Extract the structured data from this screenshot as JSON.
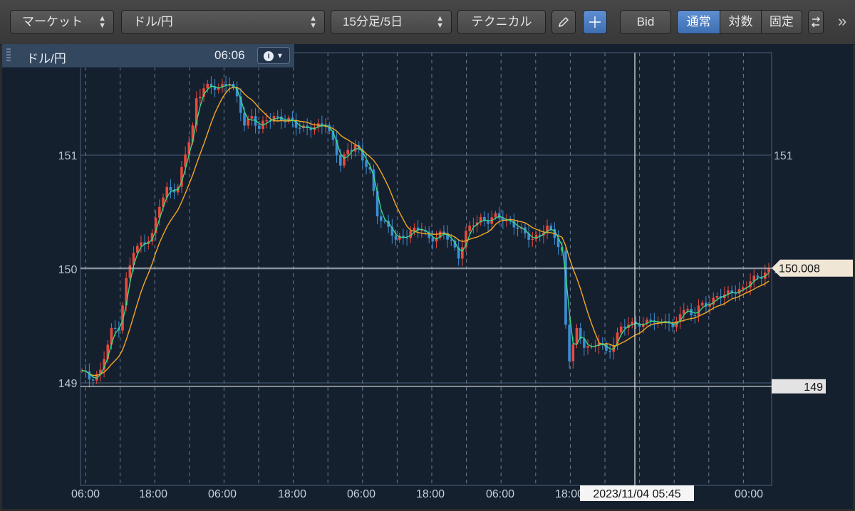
{
  "toolbar": {
    "market_select": "マーケット",
    "symbol_select": "ドル/円",
    "timeframe_select": "15分足/5日",
    "technical_button": "テクニカル",
    "pencil_icon": "pencil-icon",
    "crosshair_icon": "crosshair-icon",
    "bid_button": "Bid",
    "scale_modes": [
      "通常",
      "対数",
      "固定"
    ],
    "active_scale": "通常",
    "more_icon": "chevrons-right-icon",
    "swap_icon": "swap-icon"
  },
  "info_bar": {
    "symbol": "ドル/円",
    "time": "06:06",
    "info_icon": "info-icon"
  },
  "chart_data": {
    "type": "candlestick",
    "symbol": "ドル/円",
    "timeframe": "15分足/5日",
    "y_ticks_left": [
      "151",
      "150",
      "149"
    ],
    "y_ticks_right": [
      "151",
      "150",
      "149"
    ],
    "x_ticks": [
      "06:00",
      "18:00",
      "06:00",
      "18:00",
      "06:00",
      "18:00",
      "06:00",
      "18:00",
      "06:00",
      "00:00"
    ],
    "ylim": [
      148.1,
      151.9
    ],
    "current_price_label": "150.008",
    "current_price": 150.008,
    "crosshair_price_label": "149",
    "crosshair_price": 148.97,
    "crosshair_time_label": "2023/11/04 05:45",
    "close_path": [
      [
        0,
        149.09
      ],
      [
        2,
        149.04
      ],
      [
        5,
        149.1
      ],
      [
        8,
        149.45
      ],
      [
        10,
        149.5
      ],
      [
        12,
        149.9
      ],
      [
        14,
        150.15
      ],
      [
        17,
        150.25
      ],
      [
        19,
        150.3
      ],
      [
        21,
        150.55
      ],
      [
        23,
        150.7
      ],
      [
        26,
        150.72
      ],
      [
        28,
        151.0
      ],
      [
        30,
        151.25
      ],
      [
        31,
        151.5
      ],
      [
        33,
        151.6
      ],
      [
        35,
        151.58
      ],
      [
        37,
        151.6
      ],
      [
        40,
        151.65
      ],
      [
        42,
        151.48
      ],
      [
        44,
        151.28
      ],
      [
        46,
        151.35
      ],
      [
        48,
        151.22
      ],
      [
        50,
        151.3
      ],
      [
        52,
        151.35
      ],
      [
        55,
        151.3
      ],
      [
        57,
        151.28
      ],
      [
        60,
        151.25
      ],
      [
        63,
        151.22
      ],
      [
        66,
        151.3
      ],
      [
        68,
        151.12
      ],
      [
        70,
        150.9
      ],
      [
        72,
        151.05
      ],
      [
        74,
        151.1
      ],
      [
        76,
        150.95
      ],
      [
        78,
        150.85
      ],
      [
        80,
        150.5
      ],
      [
        83,
        150.35
      ],
      [
        85,
        150.25
      ],
      [
        87,
        150.3
      ],
      [
        89,
        150.32
      ],
      [
        92,
        150.35
      ],
      [
        94,
        150.28
      ],
      [
        96,
        150.28
      ],
      [
        98,
        150.3
      ],
      [
        100,
        150.25
      ],
      [
        102,
        150.12
      ],
      [
        104,
        150.3
      ],
      [
        106,
        150.4
      ],
      [
        108,
        150.45
      ],
      [
        110,
        150.42
      ],
      [
        112,
        150.45
      ],
      [
        114,
        150.45
      ],
      [
        116,
        150.42
      ],
      [
        118,
        150.35
      ],
      [
        120,
        150.3
      ],
      [
        122,
        150.28
      ],
      [
        124,
        150.3
      ],
      [
        126,
        150.35
      ],
      [
        128,
        150.3
      ],
      [
        130,
        150.15
      ],
      [
        131,
        149.5
      ],
      [
        132,
        149.2
      ],
      [
        134,
        149.45
      ],
      [
        136,
        149.35
      ],
      [
        138,
        149.3
      ],
      [
        140,
        149.35
      ],
      [
        142,
        149.28
      ],
      [
        144,
        149.35
      ],
      [
        146,
        149.48
      ],
      [
        148,
        149.5
      ],
      [
        150,
        149.55
      ],
      [
        152,
        149.5
      ],
      [
        154,
        149.55
      ],
      [
        156,
        149.52
      ],
      [
        158,
        149.58
      ],
      [
        160,
        149.45
      ],
      [
        162,
        149.62
      ],
      [
        164,
        149.65
      ],
      [
        166,
        149.6
      ],
      [
        168,
        149.68
      ],
      [
        170,
        149.7
      ],
      [
        172,
        149.78
      ],
      [
        174,
        149.75
      ],
      [
        176,
        149.8
      ],
      [
        178,
        149.82
      ],
      [
        180,
        149.86
      ],
      [
        182,
        149.9
      ],
      [
        184,
        149.95
      ],
      [
        186,
        150.008
      ]
    ],
    "fast_ma_color": "#3ddc84",
    "slow_ma_color": "#f5a623",
    "up_candle_color": "#e84a3c",
    "down_candle_color": "#3a8fd6",
    "grid": true,
    "background": "#15202f"
  }
}
